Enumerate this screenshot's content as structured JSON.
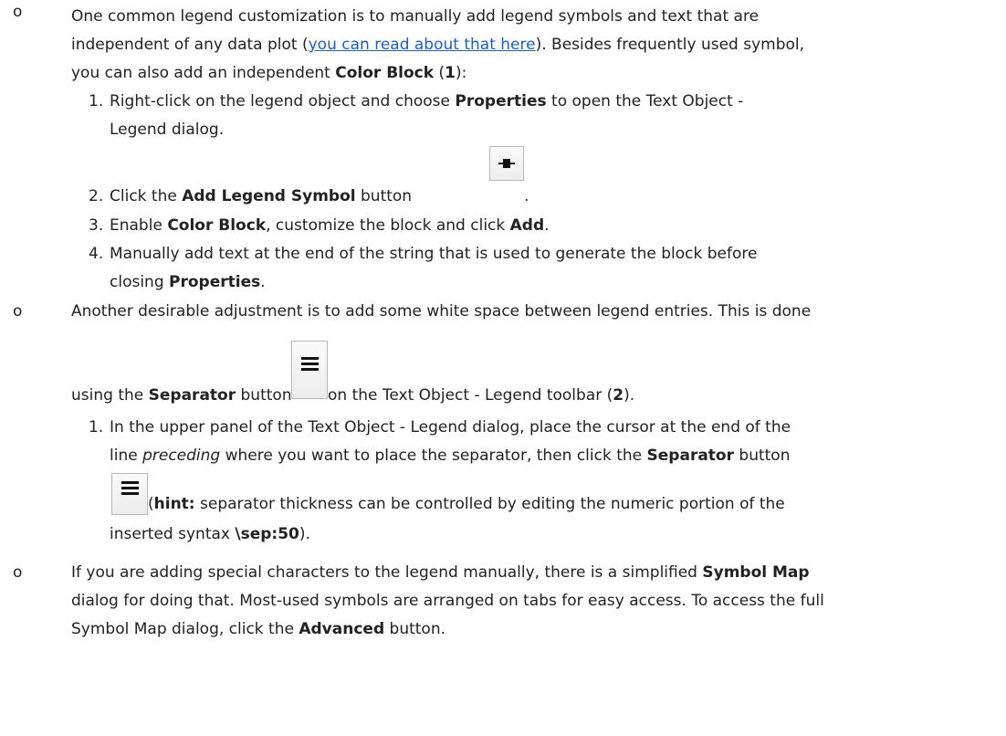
{
  "bullets": [
    {
      "marker": "o",
      "l1": "One common legend customization is to manually add legend symbols and text that are",
      "l2_a": "independent of any data plot (",
      "l2_link": "you can read about that here",
      "l2_b": "). Besides frequently used symbol,",
      "l3_a": "you can also add an independent ",
      "l3_b": "Color Block",
      "l3_c": " (",
      "l3_d": "1",
      "l3_e": "):",
      "steps": [
        {
          "num": "1.",
          "a": "Right-click on the legend object and choose ",
          "b": "Properties",
          "c": " to open the Text Object -",
          "d": "Legend dialog."
        },
        {
          "num": "2.",
          "a": "Click the ",
          "b": "Add Legend Symbol",
          "c": " button ",
          "d": "."
        },
        {
          "num": "3.",
          "a": "Enable ",
          "b": "Color Block",
          "c": ", customize the block and click ",
          "d": "Add",
          "e": "."
        },
        {
          "num": "4.",
          "a": "Manually add text at the end of the string that is used to generate the block before",
          "b": "closing ",
          "c": "Properties",
          "d": "."
        }
      ]
    },
    {
      "marker": "o",
      "l1": "Another desirable adjustment is to add some white space between legend entries. This is done",
      "l2_a": "using the ",
      "l2_b": "Separator",
      "l2_c": " button ",
      "l2_d": "on the Text Object - Legend toolbar (",
      "l2_e": "2",
      "l2_f": ").",
      "step": {
        "num": "1.",
        "l1": "In the upper panel of the Text Object - Legend dialog, place the cursor at the end of the",
        "l2_a": "line ",
        "l2_b": "preceding",
        "l2_c": " where you want to place the separator, then click the ",
        "l2_d": "Separator",
        "l2_e": " button",
        "l3_a": " (",
        "l3_b": "hint:",
        "l3_c": " separator thickness can be controlled by editing the numeric portion of the",
        "l4_a": "inserted syntax ",
        "l4_b": "\\sep:50",
        "l4_c": ")."
      }
    },
    {
      "marker": "o",
      "l1_a": "If you are adding special characters to the legend manually, there is a simplified ",
      "l1_b": "Symbol Map",
      "l2": "dialog for doing that. Most-used symbols are arranged on tabs for easy access. To access the full",
      "l3_a": "Symbol Map dialog, click the ",
      "l3_b": "Advanced",
      "l3_c": " button."
    }
  ],
  "icons": {
    "add_legend_symbol": "add-legend-symbol-icon",
    "separator": "separator-icon"
  }
}
